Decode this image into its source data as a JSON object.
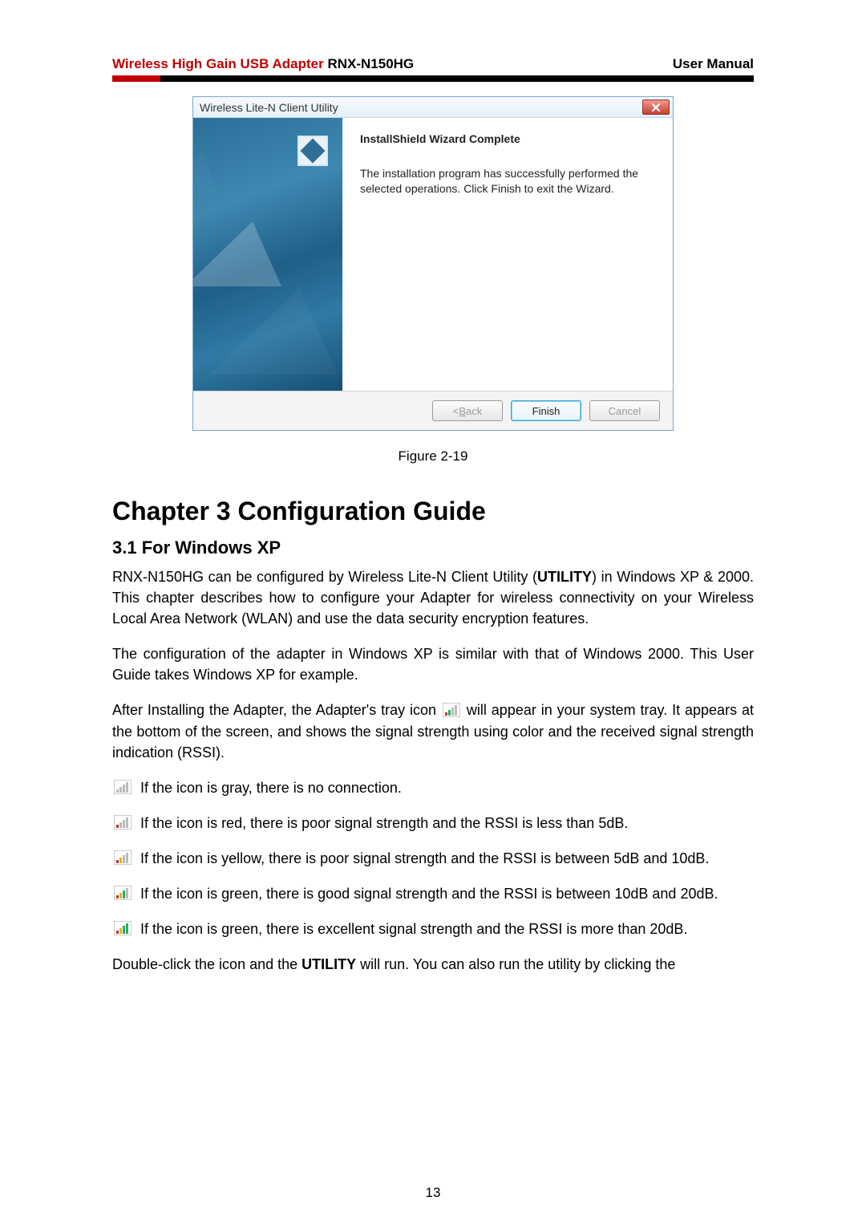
{
  "header": {
    "title_red": "Wireless High Gain USB Adapter",
    "model": "RNX-N150HG",
    "right": "User Manual"
  },
  "dialog": {
    "title": "Wireless Lite-N Client Utility",
    "close": "x",
    "heading": "InstallShield Wizard Complete",
    "body": "The installation program has successfully performed the selected operations.  Click Finish to exit the Wizard.",
    "back": "< Back",
    "finish": "Finish",
    "cancel": "Cancel",
    "back_underline_letter": "B"
  },
  "figure_caption": "Figure 2-19",
  "chapter_title": "Chapter 3  Configuration Guide",
  "section_title": "3.1   For Windows XP",
  "p1_a": "RNX-N150HG can be configured by Wireless Lite-N Client Utility (",
  "p1_bold": "UTILITY",
  "p1_b": ") in Windows XP & 2000. This chapter describes how to configure your Adapter for wireless connectivity on your Wireless Local Area Network (WLAN) and use the data security encryption features.",
  "p2": "The configuration of the adapter in Windows XP is similar with that of Windows 2000. This User Guide takes Windows XP for example.",
  "p3_a": "After Installing the Adapter, the Adapter's tray icon ",
  "p3_b": " will appear in your system tray. It appears at the bottom of the screen, and shows the signal strength using color and the received signal strength indication (RSSI).",
  "rows": {
    "gray": "If the icon is gray, there is no connection.",
    "red": "If the icon is red, there is poor signal strength and the RSSI is less than 5dB.",
    "yellow": "If the icon is yellow, there is poor signal strength and the RSSI is between 5dB and 10dB.",
    "green1": "If the icon is green, there is good signal strength and the RSSI is between 10dB and 20dB.",
    "green2": "If the icon is green, there is excellent signal strength and the RSSI is more than 20dB."
  },
  "p_last_a": "Double-click the icon and the ",
  "p_last_bold": "UTILITY",
  "p_last_b": " will run. You can also run the utility by clicking the",
  "page_number": "13"
}
